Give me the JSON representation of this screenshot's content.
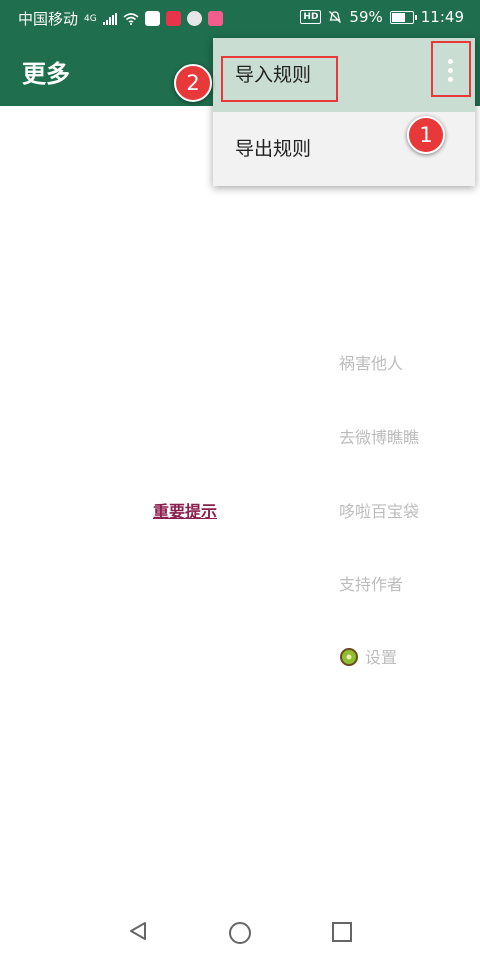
{
  "status_bar": {
    "carrier": "中国移动",
    "network": "4G",
    "battery": "59%",
    "battery_level": 0.59,
    "time": "11:49",
    "hd_label": "HD",
    "app_icons": [
      "baidu-icon",
      "taobao-icon",
      "wechat-icon",
      "bilibili-icon"
    ],
    "icons": [
      "signal-icon",
      "wifi-icon",
      "mute-bell-icon",
      "battery-icon"
    ]
  },
  "toolbar": {
    "title": "更多",
    "menu_icon": "more-vert-icon"
  },
  "overflow_menu": {
    "items": [
      {
        "label": "导入规则"
      },
      {
        "label": "导出规则"
      }
    ]
  },
  "annotations": {
    "badge_1": "1",
    "badge_2": "2",
    "color": "#e8383a"
  },
  "main": {
    "notice_link": "重要提示",
    "side_items": [
      {
        "label": "祸害他人"
      },
      {
        "label": "去微博瞧瞧"
      },
      {
        "label": "哆啦百宝袋"
      },
      {
        "label": "支持作者"
      },
      {
        "label": "设置",
        "icon": "kiwi-icon"
      }
    ]
  },
  "nav_bar": {
    "icons": [
      "back-icon",
      "home-icon",
      "recents-icon"
    ]
  },
  "colors": {
    "primary": "#1f6e4e",
    "notice": "#8b1f4d",
    "muted": "#bdbdbd",
    "menu_highlight": "#c9ddd3"
  }
}
